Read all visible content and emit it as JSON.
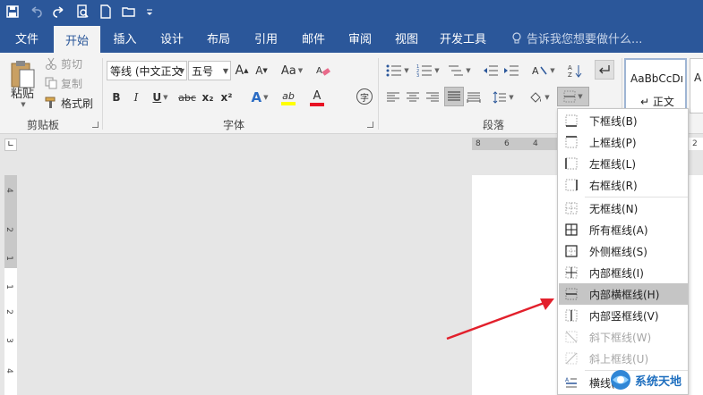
{
  "tabs": [
    "文件",
    "开始",
    "插入",
    "设计",
    "布局",
    "引用",
    "邮件",
    "审阅",
    "视图",
    "开发工具"
  ],
  "active_tab": "开始",
  "tell_me": "告诉我您想要做什么...",
  "clipboard": {
    "paste": "粘贴",
    "cut": "剪切",
    "copy": "复制",
    "format_painter": "格式刷",
    "label": "剪贴板"
  },
  "font": {
    "name": "等线 (中文正文",
    "size": "五号",
    "label": "字体",
    "bold": "B",
    "italic": "I",
    "underline": "U",
    "strike": "abc",
    "subscript": "x₂",
    "superscript": "x²",
    "change_case": "Aa",
    "grow": "A",
    "shrink": "A",
    "text_effect": "A",
    "highlight": "ab",
    "font_color": "A",
    "char_border": "字"
  },
  "paragraph": {
    "label": "段落"
  },
  "styles": [
    {
      "sample": "AaBbCcDı",
      "name": "↵ 正文"
    },
    {
      "sample": "A",
      "name": ""
    }
  ],
  "ruler": {
    "h_ticks": [
      "8",
      "6",
      "4",
      "2"
    ],
    "v_ticks": [
      "4",
      "2",
      "2",
      "1",
      "1",
      "2",
      "3",
      "4"
    ]
  },
  "border_menu": {
    "items": [
      {
        "label": "下框线(B)",
        "icon": "bottom-border-icon",
        "state": "normal"
      },
      {
        "label": "上框线(P)",
        "icon": "top-border-icon",
        "state": "normal"
      },
      {
        "label": "左框线(L)",
        "icon": "left-border-icon",
        "state": "normal"
      },
      {
        "label": "右框线(R)",
        "icon": "right-border-icon",
        "state": "normal"
      },
      {
        "label": "无框线(N)",
        "icon": "no-border-icon",
        "state": "normal"
      },
      {
        "label": "所有框线(A)",
        "icon": "all-borders-icon",
        "state": "normal"
      },
      {
        "label": "外侧框线(S)",
        "icon": "outside-borders-icon",
        "state": "normal"
      },
      {
        "label": "内部框线(I)",
        "icon": "inside-borders-icon",
        "state": "normal"
      },
      {
        "label": "内部横框线(H)",
        "icon": "inside-horizontal-border-icon",
        "state": "highlighted"
      },
      {
        "label": "内部竖框线(V)",
        "icon": "inside-vertical-border-icon",
        "state": "normal"
      },
      {
        "label": "斜下框线(W)",
        "icon": "diagonal-down-border-icon",
        "state": "disabled"
      },
      {
        "label": "斜上框线(U)",
        "icon": "diagonal-up-border-icon",
        "state": "disabled"
      },
      {
        "label": "横线(Z)",
        "icon": "horizontal-line-icon",
        "state": "normal"
      }
    ]
  },
  "watermark": "系统天地",
  "colors": {
    "brand": "#2b579a",
    "highlight_yellow": "#ffff00",
    "font_color_red": "#e81123",
    "menu_highlight": "#c5c5c5",
    "arrow_red": "#e2202c"
  }
}
